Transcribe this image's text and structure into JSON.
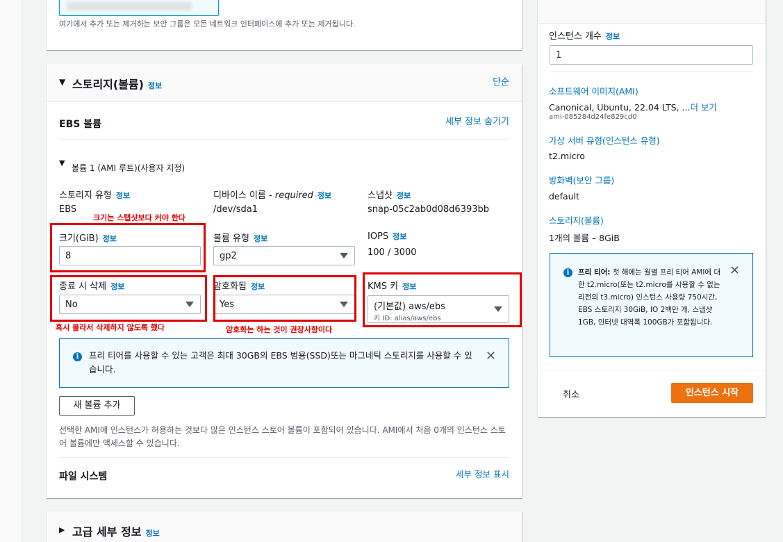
{
  "security": {
    "note": "여기에서 추가 또는 제거하는 보안 그룹은 모든 네트워크 인터페이스에 추가 또는 제거됩니다."
  },
  "storage": {
    "title": "스토리지(볼륨)",
    "info": "정보",
    "simple": "단순",
    "ebs_title": "EBS 볼륨",
    "hide_details": "세부 정보 숨기기",
    "volume_title": "볼륨 1 (AMI 루트)(사용자 지정)",
    "storage_type_label": "스토리지 유형",
    "storage_type_value": "EBS",
    "device_name_label": "디바이스 이름 - ",
    "device_name_required": "required",
    "device_name_value": "/dev/sda1",
    "snapshot_label": "스냅샷",
    "snapshot_value": "snap-05c2ab0d08d6393bb",
    "size_label": "크기(GiB)",
    "size_value": "8",
    "volume_type_label": "볼륨 유형",
    "volume_type_value": "gp2",
    "iops_label": "IOPS",
    "iops_value": "100 / 3000",
    "delete_label": "종료 시 삭제",
    "delete_value": "No",
    "encrypted_label": "암호화됨",
    "encrypted_value": "Yes",
    "kms_label": "KMS 키",
    "kms_value": "(기본값) aws/ebs",
    "kms_sub": "키 ID: alias/aws/ebs",
    "free_tier_alert": "프리 티어를 사용할 수 있는 고객은 최대 30GB의 EBS 범용(SSD)또는 마그네틱 스토리지를 사용할 수 있습니다.",
    "add_volume": "새 볼륨 추가",
    "ami_note": "선택한 AMI에 인스턴스가 허용하는 것보다 많은 인스턴스 스토어 볼륨이 포함되어 있습니다. AMI에서 처음 0개의 인스턴스 스토어 볼륨에만 액세스할 수 있습니다.",
    "file_system": "파일 시스템",
    "show_details": "세부 정보 표시"
  },
  "advanced": {
    "title": "고급 세부 정보",
    "info": "정보"
  },
  "annotations": {
    "size_note": "크기는 스탭샷보다 커야 한다",
    "delete_note": "혹시 몰라서 삭제하지 않도록 했다",
    "encrypt_note": "암호화는 하는 것이 권장사항이다"
  },
  "summary": {
    "instance_count_label": "인스턴스 개수",
    "info": "정보",
    "instance_count_value": "1",
    "ami_label": "소프트웨어 이미지(AMI)",
    "ami_value": "Canonical, Ubuntu, 22.04 LTS, ...",
    "ami_more": "더 보기",
    "ami_id": "ami-085284d24fe829cd0",
    "instance_type_label": "가상 서버 유형(인스턴스 유형)",
    "instance_type_value": "t2.micro",
    "firewall_label": "방화벽(보안 그룹)",
    "firewall_value": "default",
    "storage_label": "스토리지(볼륨)",
    "storage_value": "1개의 볼륨 – 8GiB",
    "free_tier_title": "프리 티어:",
    "free_tier_text": " 첫 해에는 월별 프리 티어 AMI에 대한 t2.micro(또는 t2.micro를 사용할 수 없는 리전의 t3.micro) 인스턴스 사용량 750시간, EBS 스토리지 30GiB, IO 2백만 개, 스냅샷 1GB, 인터넷 대역폭 100GB가 포함됩니다.",
    "cancel": "취소",
    "launch": "인스턴스 시작"
  },
  "colors": {
    "accent": "#ec7211",
    "link": "#0073bb",
    "annotation": "#e00000"
  }
}
